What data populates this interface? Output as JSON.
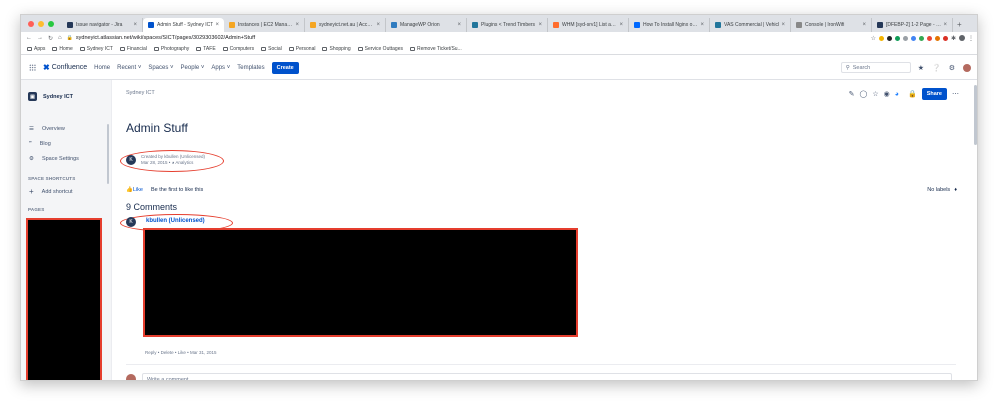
{
  "browser": {
    "tabs": [
      {
        "title": "Issue navigator - Jira",
        "color": "#253858",
        "active": false
      },
      {
        "title": "Admin Stuff - Sydney ICT",
        "color": "#0052cc",
        "active": true
      },
      {
        "title": "Instances | EC2 Manageme",
        "color": "#f5a623",
        "active": false
      },
      {
        "title": "sydneyict.net.au | Accoun",
        "color": "#f5a623",
        "active": false
      },
      {
        "title": "ManageWP Orion",
        "color": "#2f7bbf",
        "active": false
      },
      {
        "title": "Plugins < Trend Timbers",
        "color": "#21759b",
        "active": false
      },
      {
        "title": "WHM [syd-srv1] List acco",
        "color": "#ff6c2c",
        "active": false
      },
      {
        "title": "How To Install Nginx on Ce",
        "color": "#0069ff",
        "active": false
      },
      {
        "title": "VAS Commercial | Vehicl",
        "color": "#21759b",
        "active": false
      },
      {
        "title": "Console | IronWifi",
        "color": "#888888",
        "active": false
      },
      {
        "title": "[DFEBP-2] 1-2 Page - PDF",
        "color": "#253858",
        "active": false
      }
    ],
    "url": "sydneyict.atlassian.net/wiki/spaces/SICT/pages/3029303602/Admin+Stuff",
    "bookmarks": [
      "Apps",
      "Home",
      "Sydney ICT",
      "Financial",
      "Photography",
      "TAFE",
      "Computers",
      "Social",
      "Personal",
      "Shopping",
      "Service Outtages",
      "Remove Ticket/Su..."
    ]
  },
  "header": {
    "product": "Confluence",
    "nav": [
      "Home",
      "Recent",
      "Spaces",
      "People",
      "Apps",
      "Templates"
    ],
    "create_label": "Create",
    "search_placeholder": "Search"
  },
  "sidebar": {
    "space_name": "Sydney ICT",
    "items": [
      "Overview",
      "Blog",
      "Space Settings"
    ],
    "shortcuts_heading": "SPACE SHORTCUTS",
    "add_shortcut": "Add shortcut",
    "pages_heading": "PAGES"
  },
  "page": {
    "breadcrumb": "Sydney ICT",
    "share_label": "Share",
    "title": "Admin Stuff",
    "byline_created": "Created by kbullen (Unlicensed)",
    "byline_date": "Mar 28, 2015",
    "byline_analytics": "Analytics",
    "like_label": "Like",
    "like_prompt": "Be the first to like this",
    "labels_text": "No labels",
    "comments_heading": "9 Comments",
    "comment_author": "kbullen (Unlicensed)",
    "comment_actions": "Reply  •  Delete  •  Like  •  Mar 31, 2015",
    "write_placeholder": "Write a comment...",
    "avatar_initial": "K"
  },
  "colors": {
    "accent": "#0052cc",
    "highlight_red": "#e53e2e"
  }
}
